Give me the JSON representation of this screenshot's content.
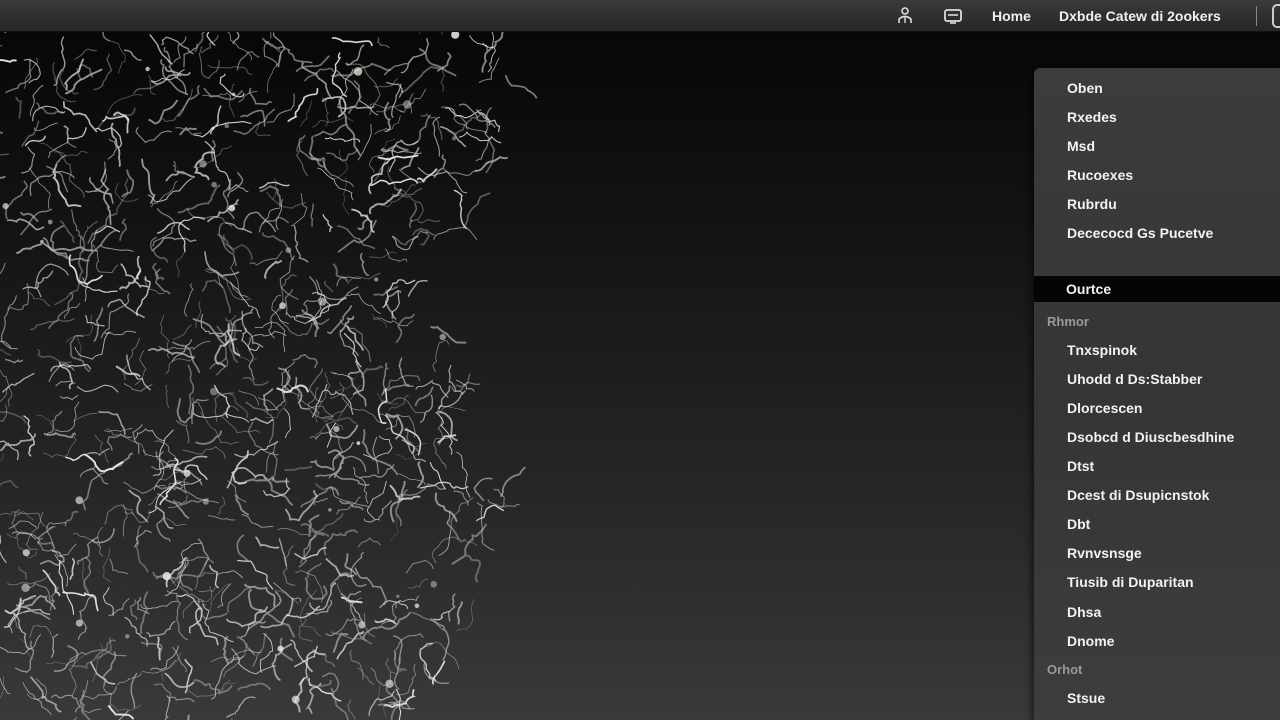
{
  "topbar": {
    "icons": [
      "people-icon",
      "display-icon"
    ],
    "nav_1": "Home",
    "nav_2": "Dxbde Catew di 2ookers"
  },
  "menu": {
    "group_1": [
      "Oben",
      "Rxedes",
      "Msd",
      "Rucoexes",
      "Rubrdu",
      "Dececocd Gs Pucetve"
    ],
    "selected": "Ourtce",
    "section_1_header": "Rhmor",
    "group_2": [
      "Tnxspinok",
      "Uhodd d Ds:Stabber",
      "Dlorcescen",
      "Dsobcd d Diuscbesdhine",
      "Dtst",
      "Dcest di Dsupicnstok",
      "Dbt",
      "Rvnvsnsge",
      "Tiusib di Duparitan",
      "Dhsa",
      "Dnome"
    ],
    "section_2_header": "Orhot",
    "group_3": [
      "Stsue"
    ]
  },
  "accent_colors": {
    "selected_bg": "#050505",
    "menu_bg": "#3a3a3a",
    "header_text": "#9a9a9a"
  }
}
